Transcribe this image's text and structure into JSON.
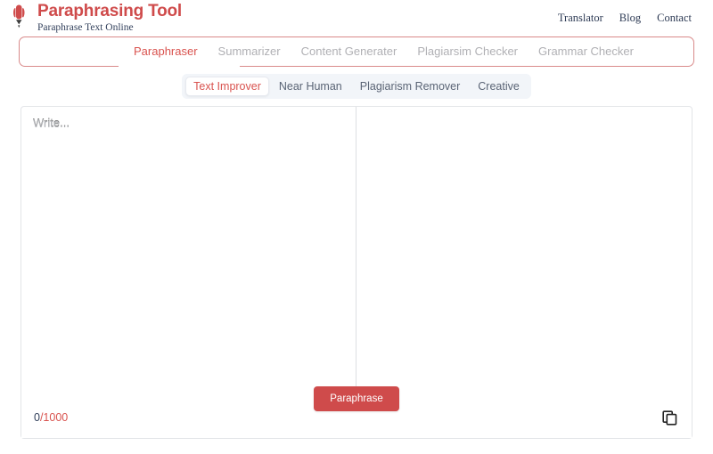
{
  "header": {
    "logo_icon": "rocket-icon",
    "title": "Paraphrasing Tool",
    "subtitle": "Paraphrase Text Online",
    "nav": [
      {
        "label": "Translator"
      },
      {
        "label": "Blog"
      },
      {
        "label": "Contact"
      }
    ]
  },
  "tabs": {
    "active_index": 0,
    "items": [
      {
        "label": "Paraphraser"
      },
      {
        "label": "Summarizer"
      },
      {
        "label": "Content Generater"
      },
      {
        "label": "Plagiarsim Checker"
      },
      {
        "label": "Grammar Checker"
      }
    ]
  },
  "subtabs": {
    "active_index": 0,
    "items": [
      {
        "label": "Text Improver"
      },
      {
        "label": "Near Human"
      },
      {
        "label": "Plagiarism Remover"
      },
      {
        "label": "Creative"
      }
    ]
  },
  "editor": {
    "input": {
      "placeholder": "Write...",
      "value": ""
    },
    "output": {
      "placeholder": "",
      "value": ""
    },
    "counter": {
      "count": "0",
      "limit": "/1000"
    },
    "cta_label": "Paraphrase",
    "copy_icon": "copy-icon"
  },
  "colors": {
    "brand_red": "#cf4b4b",
    "accent_red": "#d9534f",
    "tab_border": "#d98a8a",
    "nav_text": "#2e3b55",
    "muted_tab": "#b0b0b4",
    "subtab_bg": "#f2f5f9",
    "panel_border": "#e3e5e8"
  }
}
